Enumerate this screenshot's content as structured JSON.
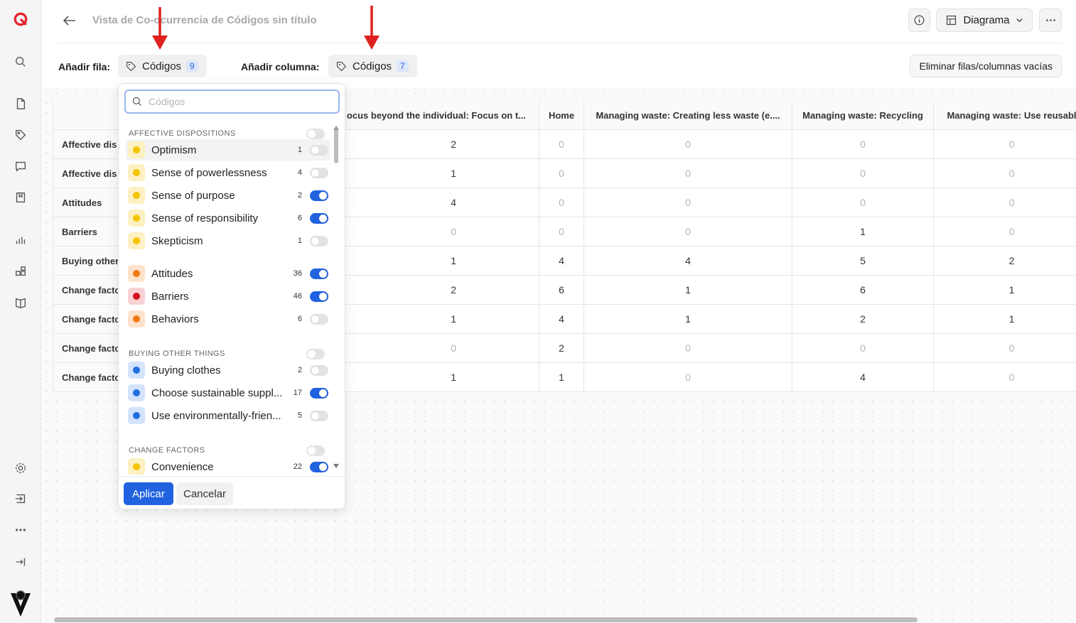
{
  "header": {
    "title": "Vista de Co-ocurrencia de Códigos sin título",
    "view_label": "Diagrama"
  },
  "toolbar": {
    "add_row_label": "Añadir fila:",
    "row_codes_label": "Códigos",
    "row_count": "9",
    "add_col_label": "Añadir columna:",
    "col_codes_label": "Códigos",
    "col_count": "7",
    "remove_empty_label": "Eliminar filas/columnas vacías"
  },
  "table": {
    "columns": [
      "ocus beyond the individual: Focus on t...",
      "Home",
      "Managing waste: Creating less waste (e....",
      "Managing waste: Recycling",
      "Managing waste: Use reusabl"
    ],
    "rows": [
      {
        "label": "Affective dis",
        "values": [
          "2",
          "0",
          "0",
          "0",
          "0"
        ]
      },
      {
        "label": "Affective dis",
        "values": [
          "1",
          "0",
          "0",
          "0",
          "0"
        ]
      },
      {
        "label": "Attitudes",
        "values": [
          "4",
          "0",
          "0",
          "0",
          "0"
        ]
      },
      {
        "label": "Barriers",
        "values": [
          "0",
          "0",
          "0",
          "1",
          "0"
        ]
      },
      {
        "label": "Buying other",
        "values": [
          "1",
          "4",
          "4",
          "5",
          "2"
        ]
      },
      {
        "label": "Change facto",
        "values": [
          "2",
          "6",
          "1",
          "6",
          "1"
        ]
      },
      {
        "label": "Change facto",
        "values": [
          "1",
          "4",
          "1",
          "2",
          "1"
        ]
      },
      {
        "label": "Change facto",
        "values": [
          "0",
          "2",
          "0",
          "0",
          "0"
        ]
      },
      {
        "label": "Change facto",
        "values": [
          "1",
          "1",
          "0",
          "4",
          "0"
        ]
      }
    ]
  },
  "dropdown": {
    "search_placeholder": "Códigos",
    "groups": [
      {
        "title": "AFFECTIVE DISPOSITIONS",
        "items": [
          {
            "label": "Optimism",
            "count": "1",
            "on": false,
            "color": "#f5c400",
            "bg": "#fdf0c2"
          },
          {
            "label": "Sense of powerlessness",
            "count": "4",
            "on": false,
            "color": "#f5c400",
            "bg": "#fdf0c2"
          },
          {
            "label": "Sense of purpose",
            "count": "2",
            "on": true,
            "color": "#f5c400",
            "bg": "#fdf0c2"
          },
          {
            "label": "Sense of responsibility",
            "count": "6",
            "on": true,
            "color": "#f5c400",
            "bg": "#fdf0c2"
          },
          {
            "label": "Skepticism",
            "count": "1",
            "on": false,
            "color": "#f5c400",
            "bg": "#fdf0c2"
          }
        ]
      },
      {
        "title": "",
        "items": [
          {
            "label": "Attitudes",
            "count": "36",
            "on": true,
            "color": "#f07a12",
            "bg": "#fde3cc"
          },
          {
            "label": "Barriers",
            "count": "46",
            "on": true,
            "color": "#d6121e",
            "bg": "#f8d2d4"
          },
          {
            "label": "Behaviors",
            "count": "6",
            "on": false,
            "color": "#f07a12",
            "bg": "#fde3cc"
          }
        ]
      },
      {
        "title": "BUYING OTHER THINGS",
        "items": [
          {
            "label": "Buying clothes",
            "count": "2",
            "on": false,
            "color": "#1f6fe3",
            "bg": "#d3e3fb"
          },
          {
            "label": "Choose sustainable suppl...",
            "count": "17",
            "on": true,
            "color": "#1f6fe3",
            "bg": "#d3e3fb"
          },
          {
            "label": "Use environmentally-frien...",
            "count": "5",
            "on": false,
            "color": "#1f6fe3",
            "bg": "#d3e3fb"
          }
        ]
      },
      {
        "title": "CHANGE FACTORS",
        "items": [
          {
            "label": "Convenience",
            "count": "22",
            "on": true,
            "color": "#f5c400",
            "bg": "#fdf0c2"
          }
        ]
      }
    ],
    "apply_label": "Aplicar",
    "cancel_label": "Cancelar"
  },
  "colors": {
    "accent": "#2162e0",
    "arrow": "#e02020"
  }
}
